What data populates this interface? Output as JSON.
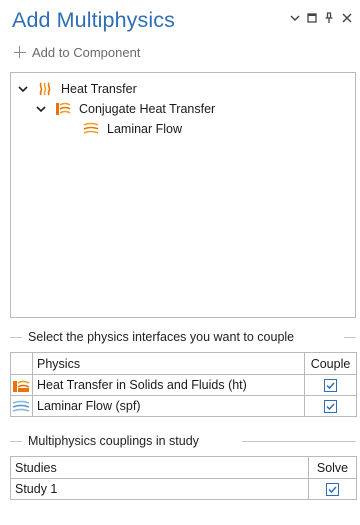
{
  "window": {
    "title": "Add Multiphysics",
    "controls": [
      {
        "name": "dropdown-icon"
      },
      {
        "name": "maximize-icon"
      },
      {
        "name": "pin-icon"
      },
      {
        "name": "close-icon"
      }
    ]
  },
  "toolbar": {
    "add_to_component_label": "Add to Component"
  },
  "tree": {
    "items": [
      {
        "label": "Heat Transfer",
        "icon": "heat-transfer-icon",
        "expanded": true,
        "level": 0
      },
      {
        "label": "Conjugate Heat Transfer",
        "icon": "conjugate-heat-transfer-icon",
        "expanded": true,
        "level": 1
      },
      {
        "label": "Laminar Flow",
        "icon": "laminar-flow-icon",
        "level": 2
      }
    ]
  },
  "physics_section": {
    "label": "Select the physics interfaces you want to couple",
    "headers": {
      "physics": "Physics",
      "couple": "Couple"
    },
    "rows": [
      {
        "icon": "heat-transfer-solids-fluids-icon",
        "name": "Heat Transfer in Solids and Fluids (ht)",
        "couple": true
      },
      {
        "icon": "laminar-flow-icon",
        "name": "Laminar Flow (spf)",
        "couple": true
      }
    ]
  },
  "study_section": {
    "label": "Multiphysics couplings in study",
    "headers": {
      "studies": "Studies",
      "solve": "Solve"
    },
    "rows": [
      {
        "name": "Study 1",
        "solve": true
      }
    ]
  },
  "colors": {
    "title": "#2f6fb5",
    "checkbox": "#2f6fb5",
    "heat_orange": "#e8730c"
  }
}
